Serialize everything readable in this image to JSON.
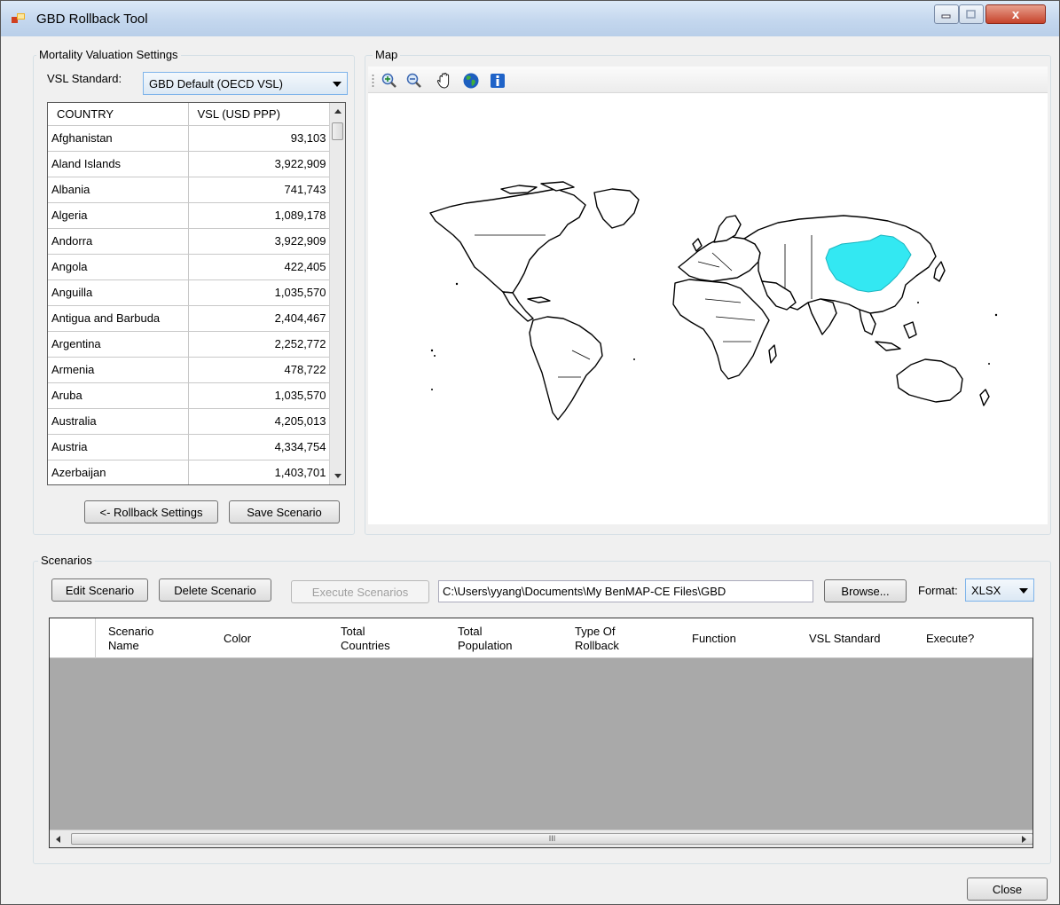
{
  "window": {
    "title": "GBD Rollback Tool",
    "close_glyph": "x"
  },
  "valuation": {
    "group_label": "Mortality Valuation Settings",
    "vsl_label": "VSL Standard:",
    "vsl_selected": "GBD Default (OECD VSL)",
    "table": {
      "headers": [
        "COUNTRY",
        "VSL (USD PPP)"
      ],
      "rows": [
        [
          "Afghanistan",
          "93,103"
        ],
        [
          "Aland Islands",
          "3,922,909"
        ],
        [
          "Albania",
          "741,743"
        ],
        [
          "Algeria",
          "1,089,178"
        ],
        [
          "Andorra",
          "3,922,909"
        ],
        [
          "Angola",
          "422,405"
        ],
        [
          "Anguilla",
          "1,035,570"
        ],
        [
          "Antigua and Barbuda",
          "2,404,467"
        ],
        [
          "Argentina",
          "2,252,772"
        ],
        [
          "Armenia",
          "478,722"
        ],
        [
          "Aruba",
          "1,035,570"
        ],
        [
          "Australia",
          "4,205,013"
        ],
        [
          "Austria",
          "4,334,754"
        ],
        [
          "Azerbaijan",
          "1,403,701"
        ]
      ]
    },
    "rollback_button": "<- Rollback Settings",
    "save_button": "Save Scenario"
  },
  "map": {
    "group_label": "Map",
    "tools": [
      "zoom-in-icon",
      "zoom-out-icon",
      "pan-hand-icon",
      "full-extent-globe-icon",
      "info-icon"
    ],
    "highlight_color": "#33e8f2"
  },
  "scenarios": {
    "group_label": "Scenarios",
    "edit_button": "Edit Scenario",
    "delete_button": "Delete Scenario",
    "execute_button": "Execute Scenarios",
    "output_path": "C:\\Users\\yyang\\Documents\\My BenMAP-CE Files\\GBD",
    "browse_button": "Browse...",
    "format_label": "Format:",
    "format_selected": "XLSX",
    "columns": [
      [
        "Scenario",
        "Name"
      ],
      [
        "Color",
        ""
      ],
      [
        "Total",
        "Countries"
      ],
      [
        "Total",
        "Population"
      ],
      [
        "Type Of",
        "Rollback"
      ],
      [
        "Function",
        ""
      ],
      [
        "VSL Standard",
        ""
      ],
      [
        "Execute?",
        ""
      ]
    ],
    "scroll_grip": "III"
  },
  "footer": {
    "close_button": "Close"
  }
}
